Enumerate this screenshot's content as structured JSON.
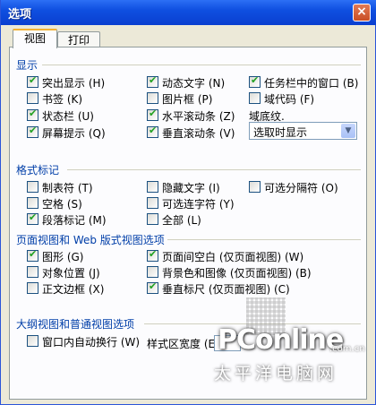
{
  "window": {
    "title": "选项",
    "close_glyph": "×"
  },
  "tabs": [
    {
      "label": "视图",
      "active": true
    },
    {
      "label": "打印",
      "active": false
    }
  ],
  "display": {
    "heading": "显示",
    "items": [
      {
        "label": "突出显示 (H)",
        "checked": true
      },
      {
        "label": "书签 (K)",
        "checked": false
      },
      {
        "label": "状态栏 (U)",
        "checked": true
      },
      {
        "label": "屏幕提示 (Q)",
        "checked": true
      },
      {
        "label": "动态文字 (N)",
        "checked": true
      },
      {
        "label": "图片框 (P)",
        "checked": false
      },
      {
        "label": "水平滚动条 (Z)",
        "checked": true
      },
      {
        "label": "垂直滚动条 (V)",
        "checked": true
      },
      {
        "label": "任务栏中的窗口 (B)",
        "checked": true
      },
      {
        "label": "域代码 (F)",
        "checked": false
      }
    ],
    "field_shading_label": "域底纹.",
    "field_shading_value": "选取时显示"
  },
  "formatting": {
    "heading": "格式标记",
    "items": [
      {
        "label": "制表符 (T)",
        "checked": false
      },
      {
        "label": "空格 (S)",
        "checked": false
      },
      {
        "label": "段落标记 (M)",
        "checked": true
      },
      {
        "label": "隐藏文字 (I)",
        "checked": false
      },
      {
        "label": "可选连字符 (Y)",
        "checked": false
      },
      {
        "label": "全部 (L)",
        "checked": false
      },
      {
        "label": "可选分隔符 (O)",
        "checked": false
      }
    ]
  },
  "page_view": {
    "heading": "页面视图和 Web 版式视图选项",
    "items": [
      {
        "label": "图形 (G)",
        "checked": true
      },
      {
        "label": "对象位置 (J)",
        "checked": false
      },
      {
        "label": "正文边框 (X)",
        "checked": false
      },
      {
        "label": "页面间空白 (仅页面视图) (W)",
        "checked": true
      },
      {
        "label": "背景色和图像 (仅页面视图) (B)",
        "checked": false
      },
      {
        "label": "垂直标尺 (仅页面视图) (C)",
        "checked": true
      }
    ]
  },
  "outline": {
    "heading": "大纲视图和普通视图选项",
    "wrap_label": "窗口内自动换行 (W)",
    "wrap_checked": false,
    "style_width_label": "样式区宽度 (E)"
  },
  "watermark": {
    "brand": "PConline",
    "domain": ".com.cn",
    "subtitle": "太平洋电脑网"
  }
}
